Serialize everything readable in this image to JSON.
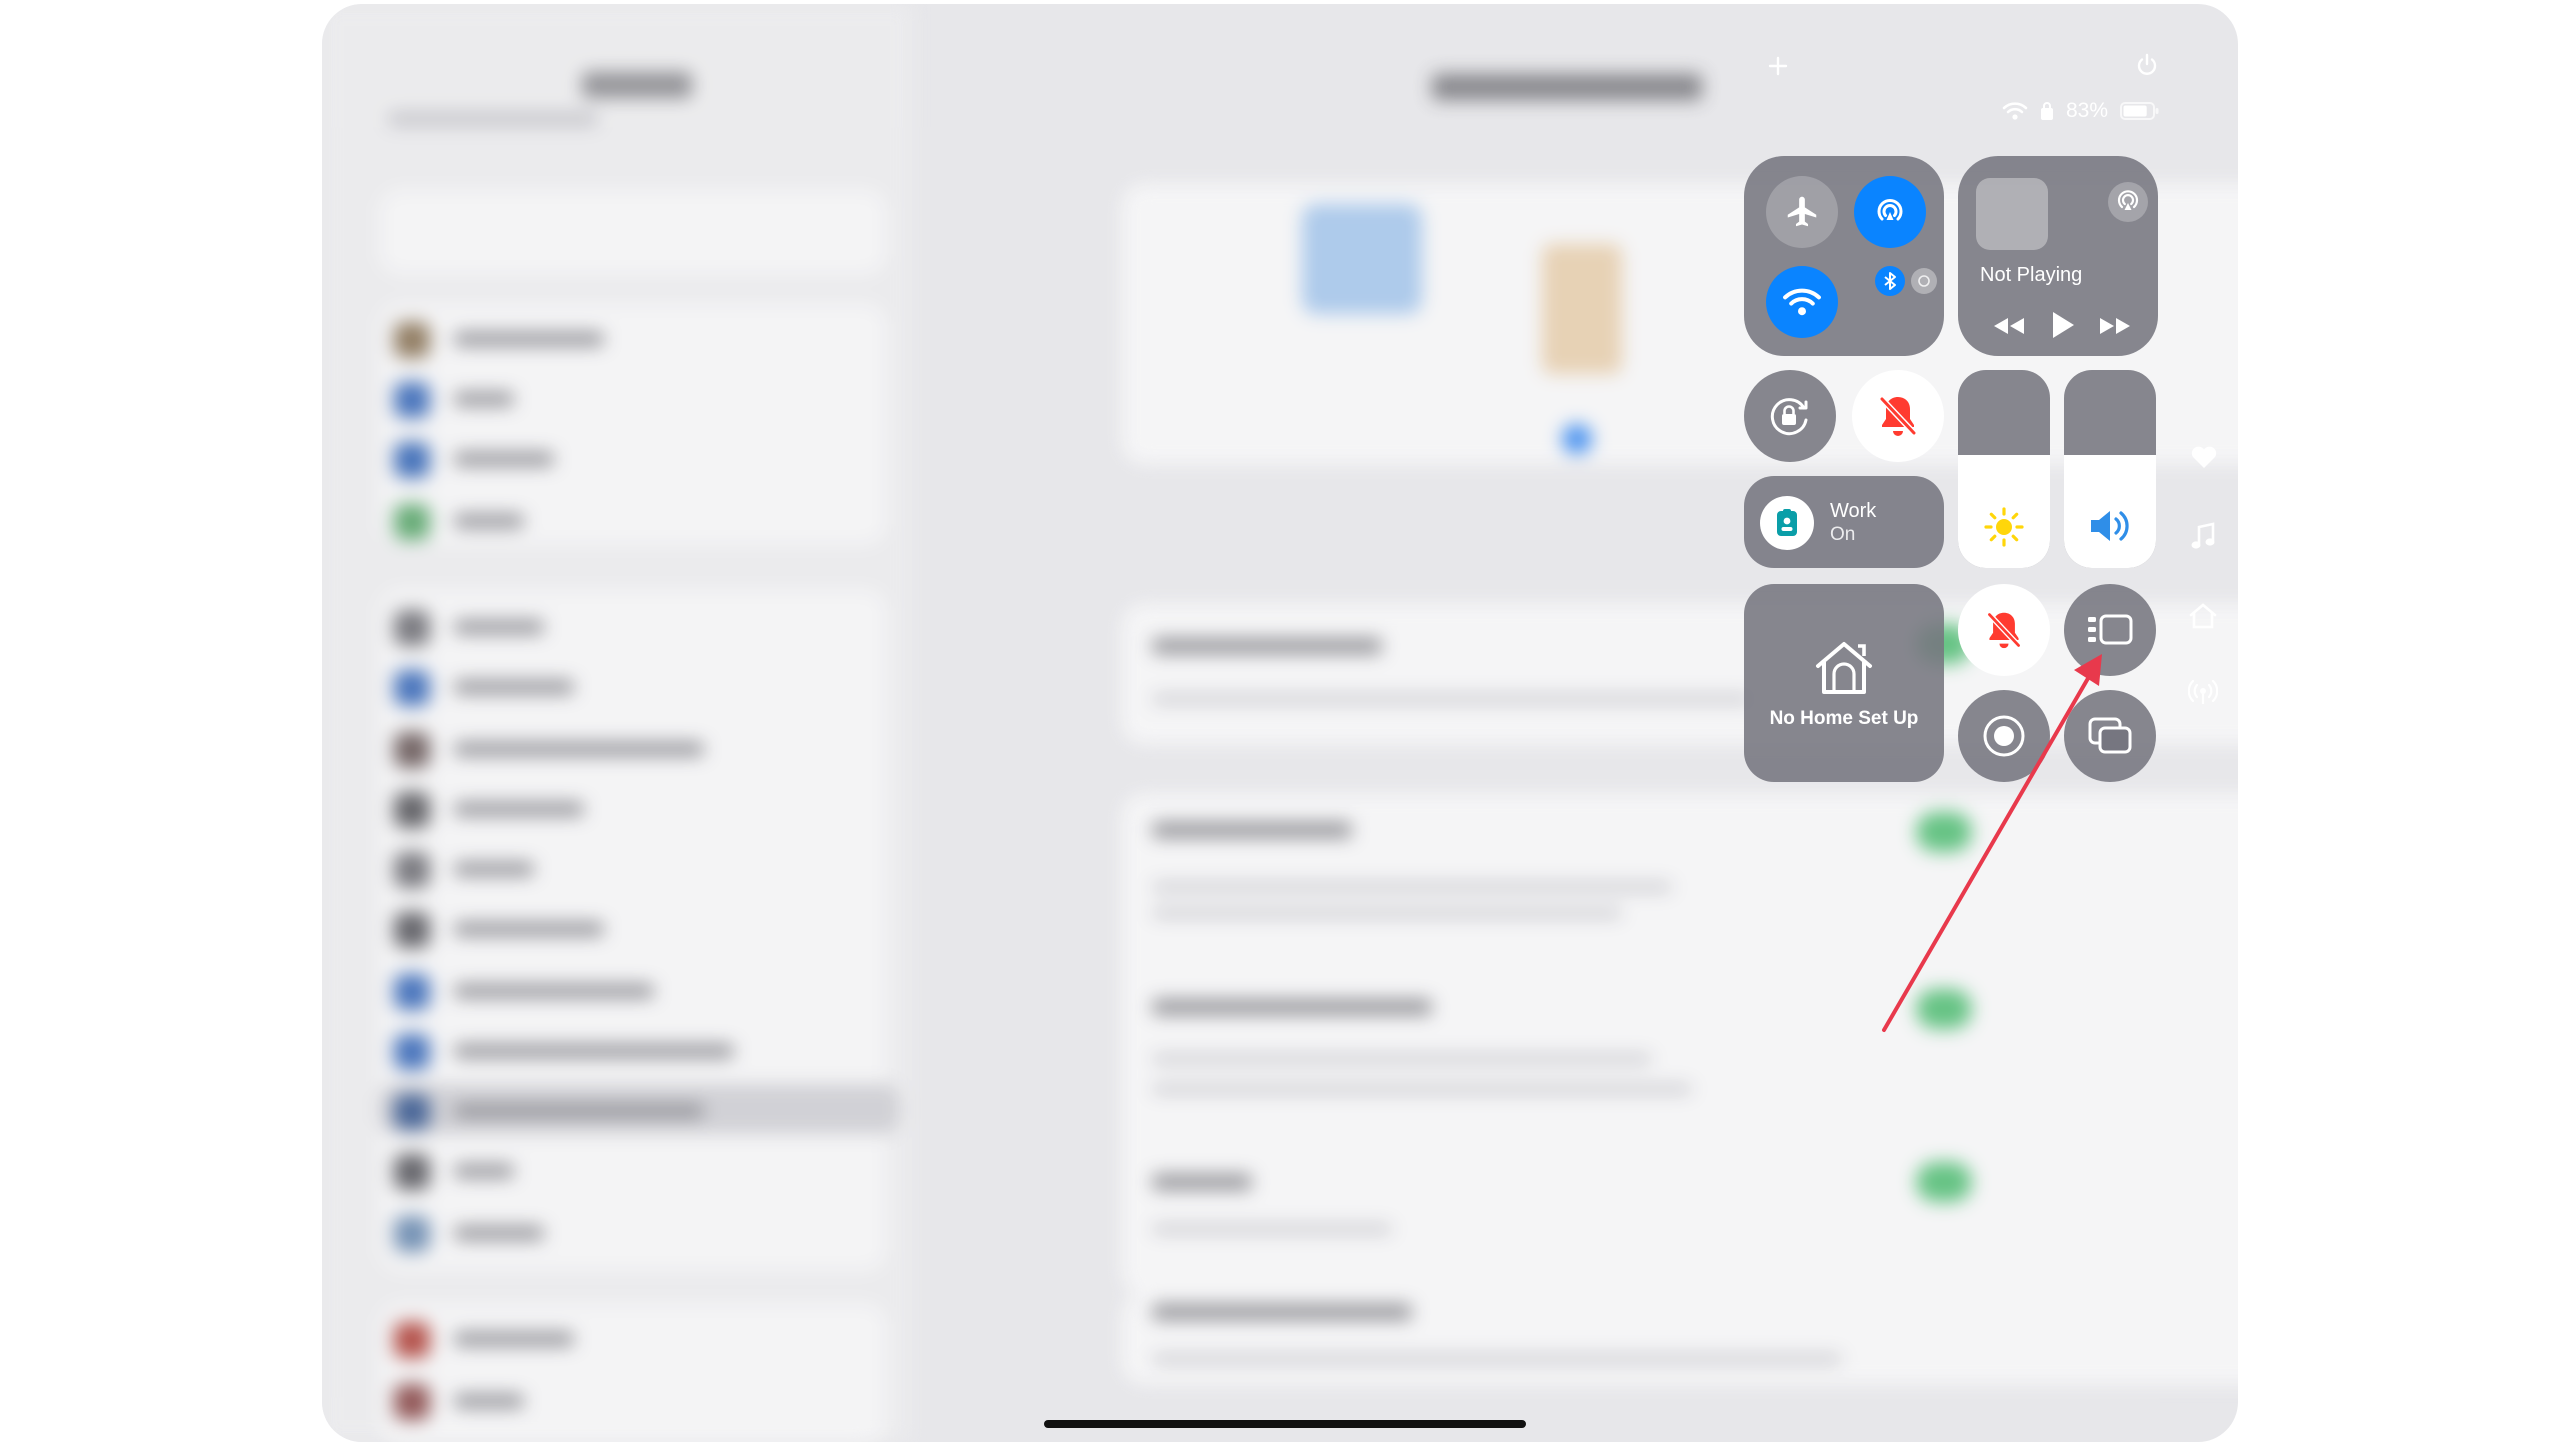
{
  "status_bar": {
    "battery_percent": "83%",
    "battery_level": 0.83
  },
  "connectivity": {
    "airplane_mode": false,
    "airdrop": true,
    "wifi": true,
    "bluetooth": true
  },
  "now_playing": {
    "label": "Not Playing"
  },
  "focus": {
    "title": "Work",
    "state": "On"
  },
  "home": {
    "label": "No Home Set Up"
  },
  "sliders": {
    "brightness_level": 0.57,
    "volume_level": 0.57
  },
  "colors": {
    "accent_blue": "#0a84ff",
    "silent_red": "#ff3b30",
    "brightness_yellow": "#ffd60a",
    "annotation_arrow": "#e8394c"
  },
  "side_icons": [
    "heart-icon",
    "music-note-icon",
    "home-icon",
    "broadcast-icon"
  ]
}
